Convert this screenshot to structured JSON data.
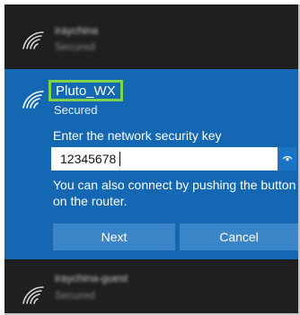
{
  "networks": {
    "top": {
      "name": "iraychina",
      "status": "Secured",
      "icon": "wifi-signal-icon"
    },
    "active": {
      "name": "Pluto_WX",
      "status": "Secured",
      "icon": "wifi-signal-icon",
      "highlight_color": "#7fd24a",
      "prompt": "Enter the network security key",
      "key_value": "12345678",
      "reveal_icon": "eye-icon",
      "info_text": "You can also connect by pushing the button on the router.",
      "next_label": "Next",
      "cancel_label": "Cancel"
    },
    "bottom": {
      "name": "iraychina-guest",
      "status": "Secured",
      "icon": "wifi-signal-icon"
    }
  },
  "colors": {
    "panel_bg": "#1f1f1f",
    "active_bg": "#1468b3",
    "button_bg": "#3a85c8"
  }
}
